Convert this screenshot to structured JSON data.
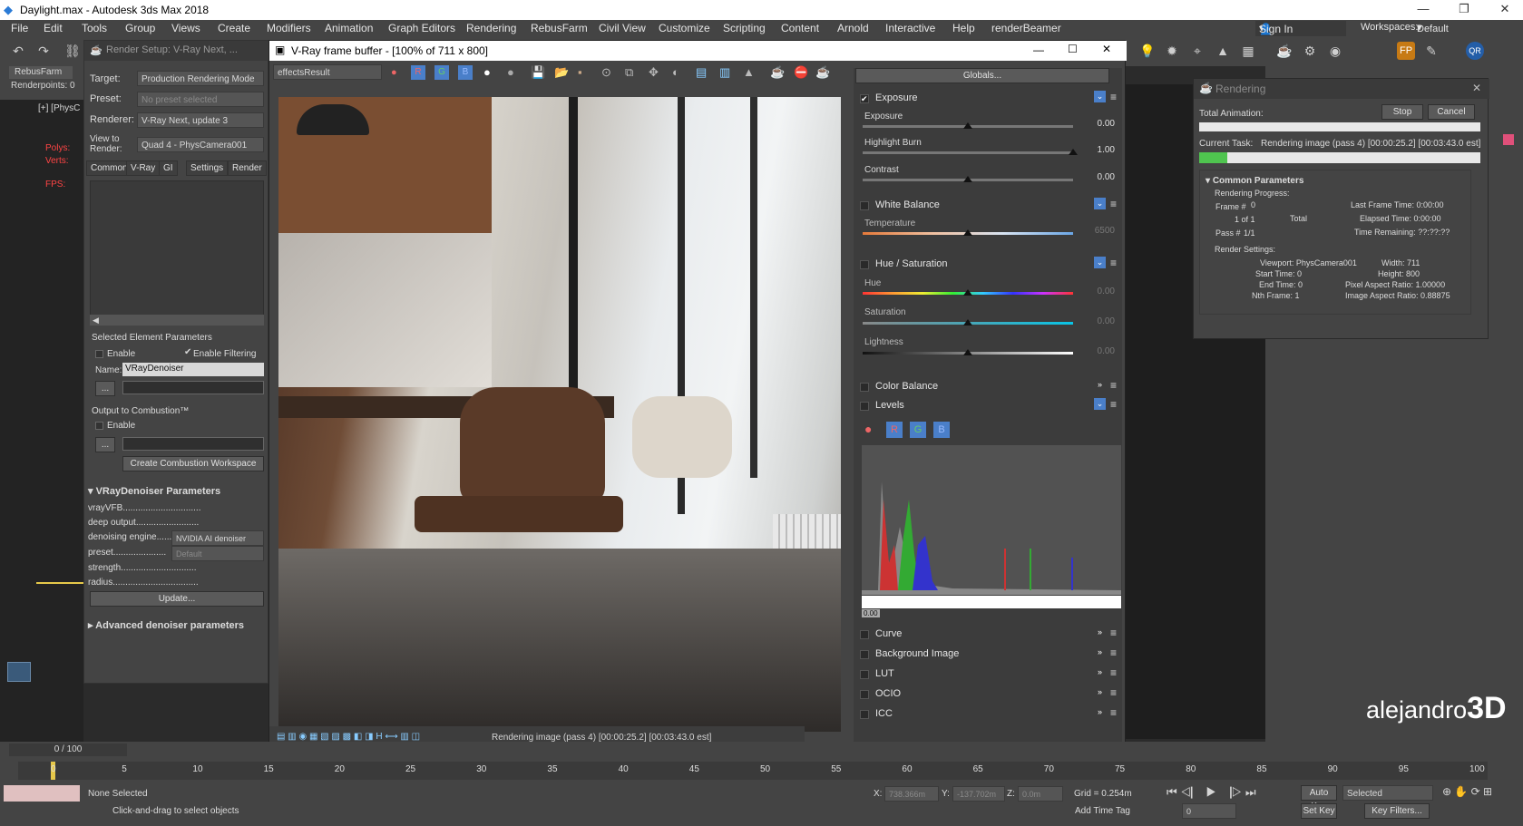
{
  "app": {
    "title": "Daylight.max - Autodesk 3ds Max 2018"
  },
  "menu": [
    "File",
    "Edit",
    "Tools",
    "Group",
    "Views",
    "Create",
    "Modifiers",
    "Animation",
    "Graph Editors",
    "Rendering",
    "RebusFarm",
    "Civil View",
    "Customize",
    "Scripting",
    "Content",
    "Arnold",
    "Interactive",
    "Help",
    "renderBeamer"
  ],
  "signin": "Sign In",
  "workspaces_label": "Workspaces:",
  "workspace": "Default",
  "left": {
    "rebus": "RebusFarm",
    "renderpoints": "Renderpoints: 0",
    "polys": "Polys:",
    "verts": "Verts:",
    "fps": "FPS:",
    "vp": "[+] [PhysC"
  },
  "render_setup": {
    "title": "Render Setup: V-Ray Next, ...",
    "target_label": "Target:",
    "target": "Production Rendering Mode",
    "preset_label": "Preset:",
    "preset": "No preset selected",
    "renderer_label": "Renderer:",
    "renderer": "V-Ray Next, update 3",
    "view_label": "View to Render:",
    "view": "Quad 4 - PhysCamera001",
    "tabs": [
      "Common",
      "V-Ray",
      "GI",
      "Settings",
      "Render"
    ],
    "sel_params": "Selected Element Parameters",
    "enable": "Enable",
    "enable_filtering": "Enable Filtering",
    "name_label": "Name:",
    "name": "VRayDenoiser",
    "dots": "...",
    "combustion": "Output to Combustion™",
    "enable2": "Enable",
    "create_combustion": "Create Combustion Workspace",
    "denoiser_params": "VRayDenoiser Parameters",
    "rows": [
      "vrayVFB...............................",
      "deep output.........................",
      "denoising engine......",
      "preset.....................",
      "strength..............................",
      "radius.................................."
    ],
    "engine": "NVIDIA AI denoiser",
    "preset_val": "Default",
    "update": "Update...",
    "advanced": "Advanced denoiser parameters"
  },
  "vfb": {
    "title": "V-Ray frame buffer - [100% of 711 x 800]",
    "channel": "effectsResult",
    "globals": "Globals...",
    "status": "Rendering image (pass 4) [00:00:25.2] [00:03:43.0 est]",
    "sections": {
      "exposure": "Exposure",
      "white_balance": "White Balance",
      "hue_sat": "Hue / Saturation",
      "color_balance": "Color Balance",
      "levels": "Levels",
      "curve": "Curve",
      "background": "Background Image",
      "lut": "LUT",
      "ocio": "OCIO",
      "icc": "ICC"
    },
    "sliders": [
      {
        "label": "Exposure",
        "value": "0.00"
      },
      {
        "label": "Highlight Burn",
        "value": "1.00"
      },
      {
        "label": "Contrast",
        "value": "0.00"
      },
      {
        "label": "Temperature",
        "value": "6500"
      },
      {
        "label": "Hue",
        "value": "0.00"
      },
      {
        "label": "Saturation",
        "value": "0.00"
      },
      {
        "label": "Lightness",
        "value": "0.00"
      }
    ],
    "levels_btns": [
      "R",
      "G",
      "B"
    ],
    "hist_min": "0.00"
  },
  "rendering": {
    "title": "Rendering",
    "stop": "Stop",
    "cancel": "Cancel",
    "total_anim": "Total Animation:",
    "current_task": "Current Task:",
    "task": "Rendering image (pass 4) [00:00:25.2] [00:03:43.0 est]",
    "progress": 0.1,
    "common": "Common Parameters",
    "rend_progress": "Rendering Progress:",
    "frame": "Frame #",
    "frame_val": "0",
    "of": "1 of 1",
    "total": "Total",
    "pass": "Pass #",
    "pass_val": "1/1",
    "last_frame": "Last Frame Time:  0:00:00",
    "elapsed": "Elapsed Time:  0:00:00",
    "remaining": "Time Remaining:  ??:??:??",
    "render_settings": "Render Settings:",
    "viewport": "Viewport:  PhysCamera001",
    "width": "Width:  711",
    "start": "Start Time:  0",
    "height": "Height:  800",
    "end": "End Time:  0",
    "pixel_aspect": "Pixel Aspect Ratio:  1.00000",
    "nth": "Nth Frame:  1",
    "image_aspect": "Image Aspect Ratio:  0.88875"
  },
  "timeline": {
    "frame": "0 / 100",
    "ticks": [
      "0",
      "5",
      "10",
      "15",
      "20",
      "25",
      "30",
      "35",
      "40",
      "45",
      "50",
      "55",
      "60",
      "65",
      "70",
      "75",
      "80",
      "85",
      "90",
      "95",
      "100"
    ],
    "none_selected": "None Selected",
    "hint": "Click-and-drag to select objects",
    "x": "X:",
    "xv": "738.366m",
    "y": "Y:",
    "yv": "-137.702m",
    "z": "Z:",
    "zv": "0.0m",
    "grid": "Grid = 0.254m",
    "add_tag": "Add Time Tag",
    "autokey": "Auto Key",
    "selected": "Selected",
    "setkey": "Set Key",
    "filters": "Key Filters...",
    "frame_num": "0"
  },
  "watermark": {
    "text": "alejandro",
    "bold": "3D"
  }
}
